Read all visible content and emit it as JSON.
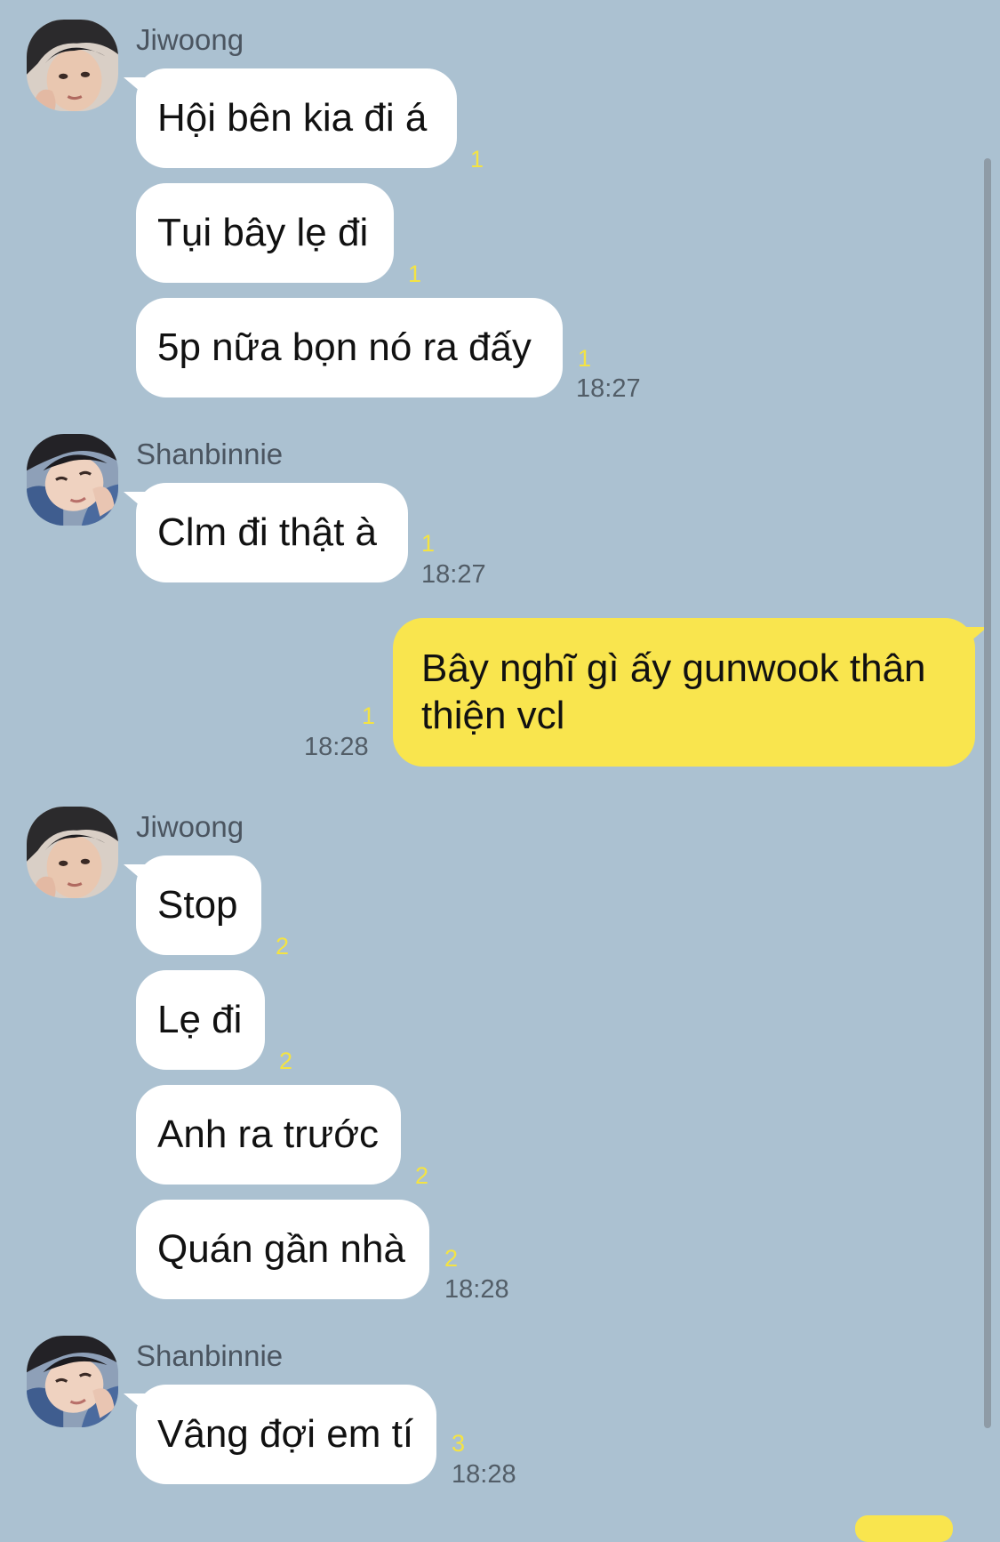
{
  "users": {
    "jiwoong": "Jiwoong",
    "shanbinnie": "Shanbinnie"
  },
  "groups": [
    {
      "sender_key": "jiwoong",
      "messages": [
        {
          "text": "Hội bên kia đi á",
          "unread": "1"
        },
        {
          "text": "Tụi bây lẹ đi",
          "unread": "1"
        },
        {
          "text": "5p nữa bọn nó ra đấy",
          "unread": "1",
          "time": "18:27"
        }
      ]
    },
    {
      "sender_key": "shanbinnie",
      "messages": [
        {
          "text": "Clm đi thật à",
          "unread": "1",
          "time": "18:27"
        }
      ]
    },
    {
      "sender_key": "me",
      "messages": [
        {
          "text": "Bây nghĩ gì ấy gunwook thân thiện vcl",
          "unread": "1",
          "time": "18:28"
        }
      ]
    },
    {
      "sender_key": "jiwoong",
      "messages": [
        {
          "text": "Stop",
          "unread": "2"
        },
        {
          "text": "Lẹ đi",
          "unread": "2"
        },
        {
          "text": "Anh ra trước",
          "unread": "2"
        },
        {
          "text": "Quán gần nhà",
          "unread": "2",
          "time": "18:28"
        }
      ]
    },
    {
      "sender_key": "shanbinnie",
      "messages": [
        {
          "text": "Vâng đợi em tí",
          "unread": "3",
          "time": "18:28"
        }
      ]
    }
  ],
  "colors": {
    "background": "#abc1d1",
    "bubble_incoming": "#ffffff",
    "bubble_outgoing": "#f9e54e",
    "unread_count": "#f4e343",
    "timestamp": "#525d67"
  }
}
